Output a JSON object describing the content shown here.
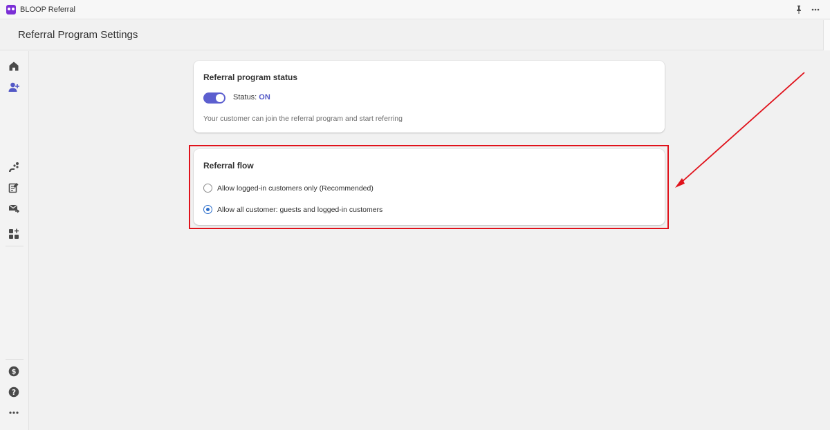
{
  "app": {
    "title": "BLOOP Referral",
    "logo_color": "#7b2fd6",
    "actions": [
      "pin-icon",
      "more-icon"
    ]
  },
  "page": {
    "title": "Referral Program Settings"
  },
  "sidebar": {
    "top_items": [
      {
        "name": "home",
        "icon": "home-icon"
      },
      {
        "name": "referral-customers",
        "icon": "add-user-icon"
      }
    ],
    "middle_items": [
      {
        "name": "campaigns",
        "icon": "share-dots-icon"
      },
      {
        "name": "rewards",
        "icon": "document-edit-icon"
      },
      {
        "name": "emails",
        "icon": "mail-send-icon"
      },
      {
        "name": "apps",
        "icon": "apps-add-icon"
      }
    ],
    "bottom_items": [
      {
        "name": "billing",
        "icon": "dollar-circle-icon"
      },
      {
        "name": "help",
        "icon": "question-circle-icon"
      },
      {
        "name": "more",
        "icon": "more-horizontal-icon"
      }
    ]
  },
  "status_card": {
    "title": "Referral program status",
    "toggle_on": true,
    "status_label": "Status: ",
    "status_value": "ON",
    "description": "Your customer can join the referral program and start referring"
  },
  "flow_card": {
    "title": "Referral flow",
    "options": [
      {
        "label": "Allow logged-in customers only (Recommended)",
        "selected": false
      },
      {
        "label": "Allow all customer: guests and logged-in customers",
        "selected": true
      }
    ]
  },
  "colors": {
    "accent": "#5c5fcf",
    "radio_selected": "#2c6ecb",
    "annotation": "#e0121b"
  }
}
